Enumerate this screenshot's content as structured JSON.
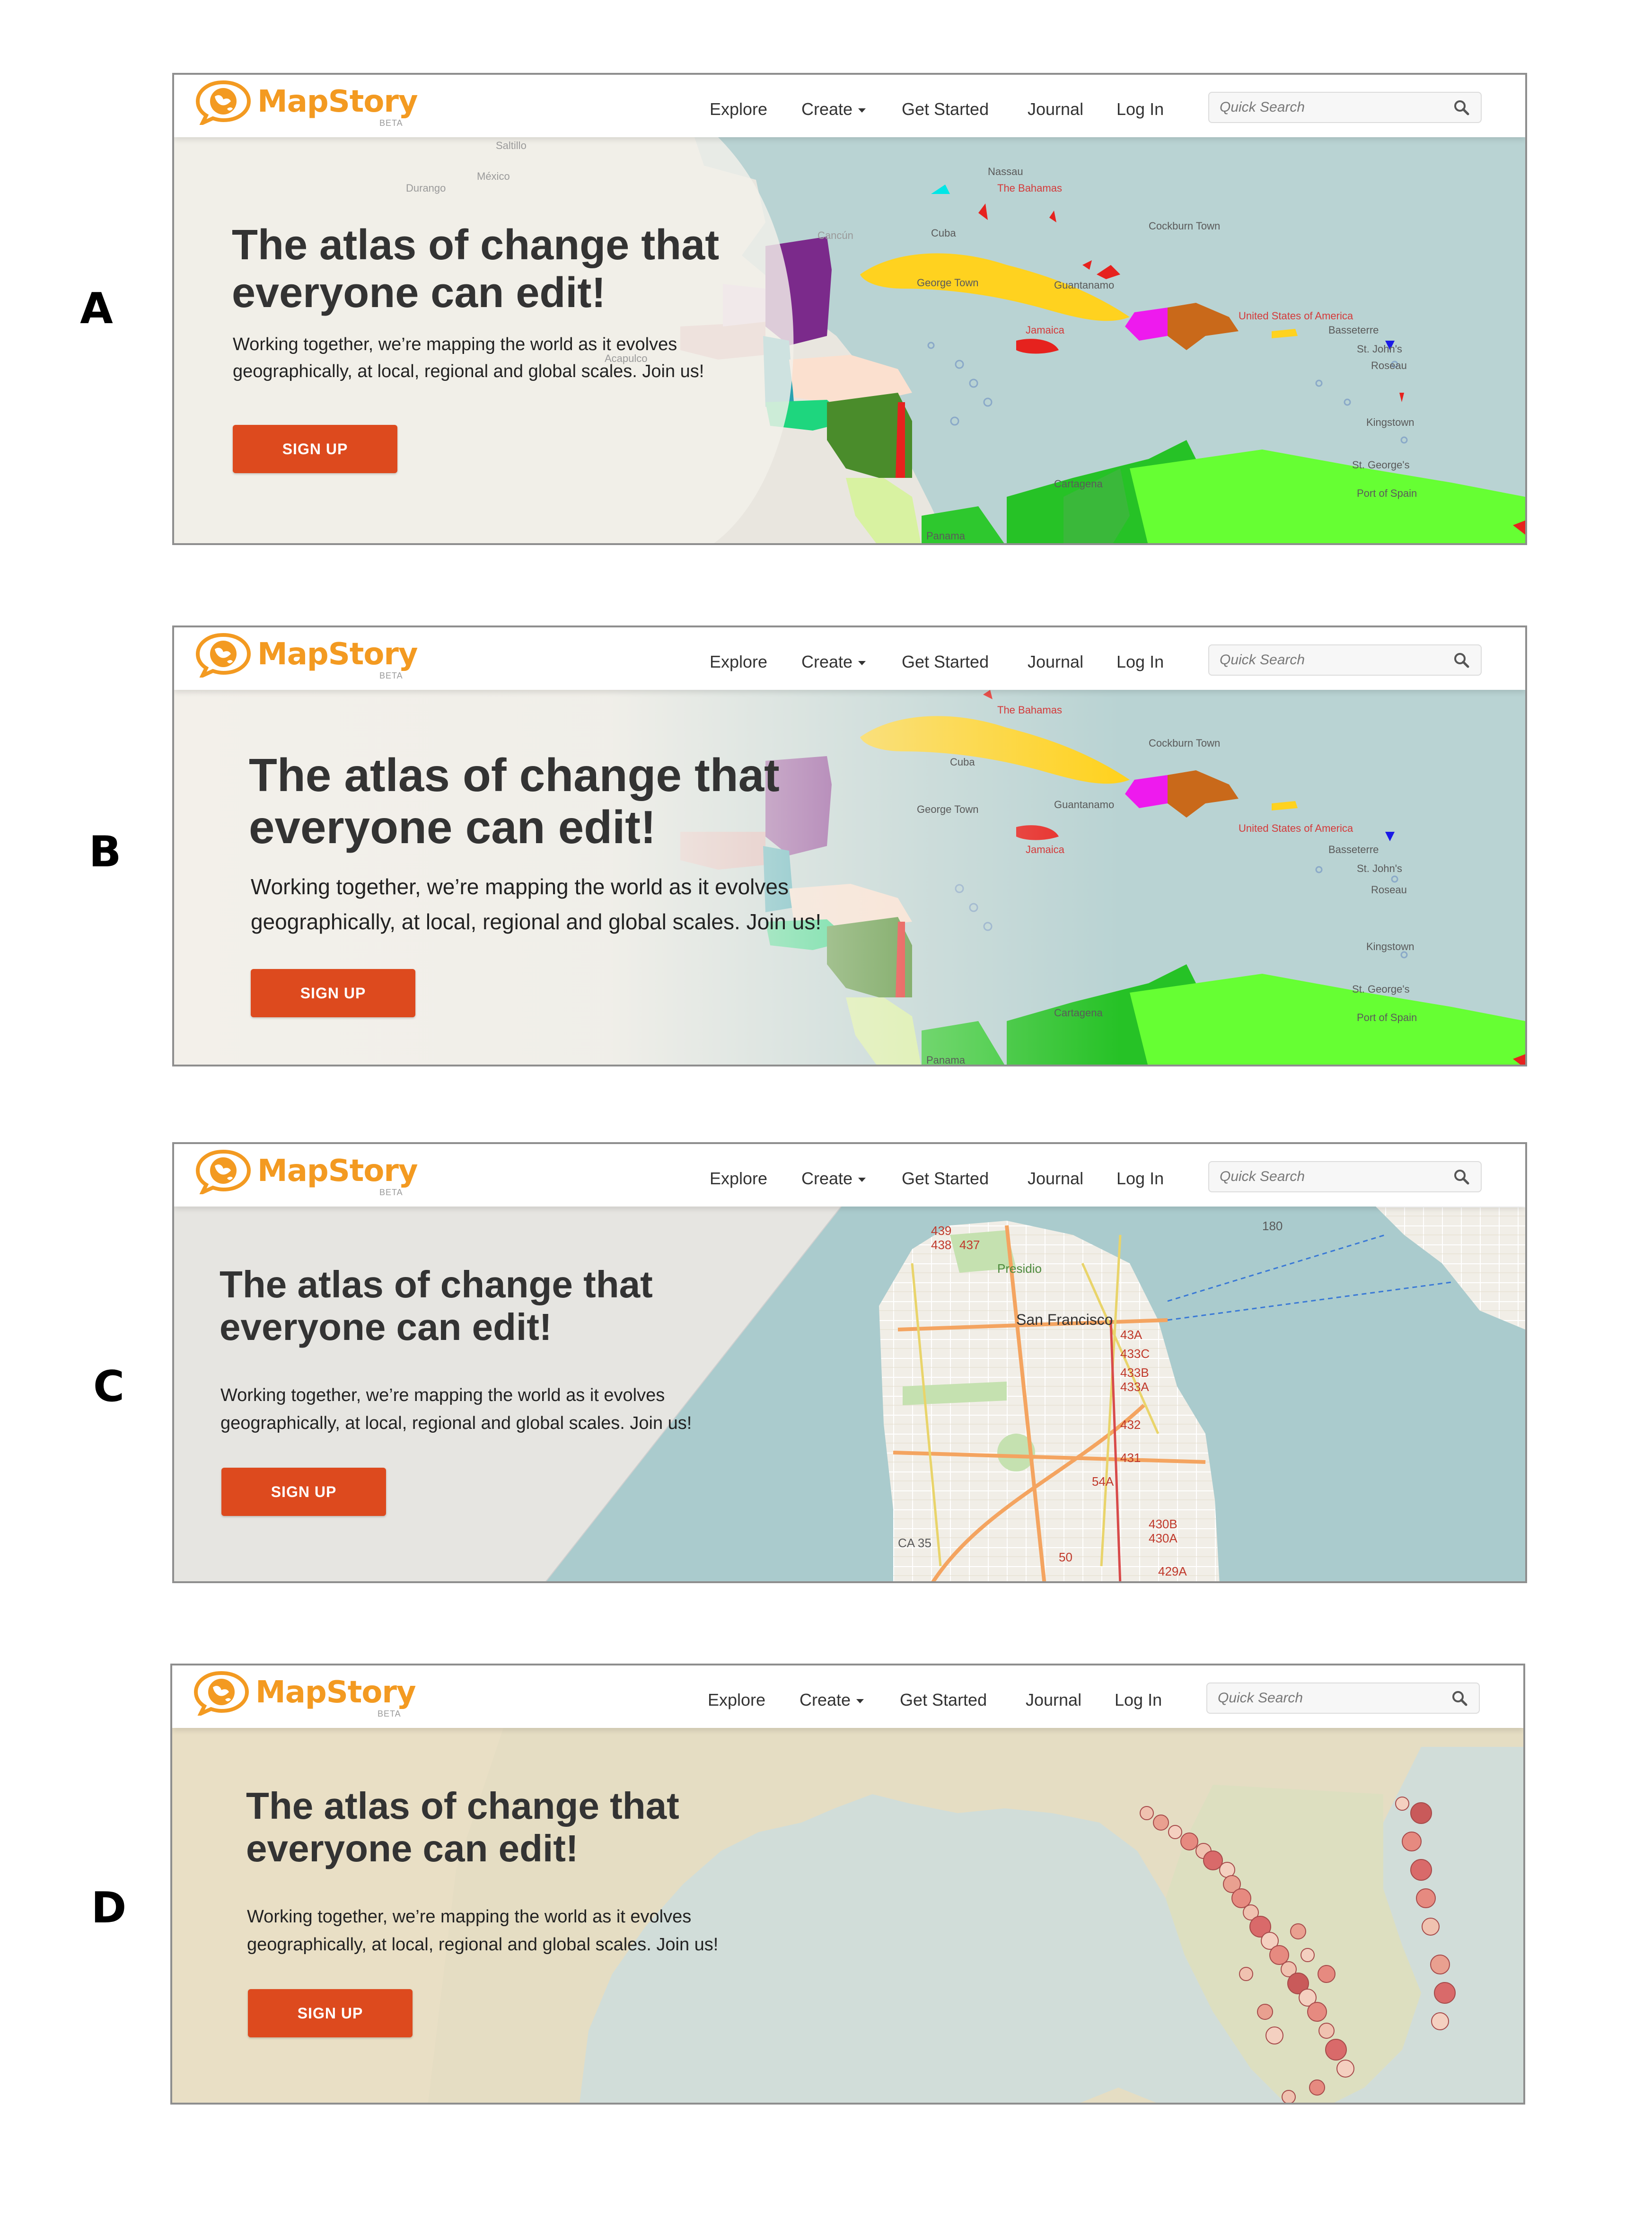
{
  "panel_labels": [
    "A",
    "B",
    "C",
    "D"
  ],
  "brand": {
    "name": "MapStory",
    "badge": "BETA",
    "color": "#f39a21"
  },
  "nav": {
    "explore": "Explore",
    "create": "Create",
    "get_started": "Get Started",
    "journal": "Journal",
    "login": "Log In"
  },
  "search": {
    "placeholder": "Quick Search",
    "icon": "search-icon"
  },
  "hero": {
    "title_line1": "The atlas of change that",
    "title_line2": "everyone can edit!",
    "subtitle_line1": "Working together, we’re mapping the world as it evolves",
    "subtitle_line2": "geographically, at local, regional and global scales. Join us!",
    "cta": "SIGN UP",
    "cta_color": "#dd4a1e"
  },
  "map_labels": {
    "caribbean": [
      "Nassau",
      "The Bahamas",
      "Cuba",
      "Cockburn Town",
      "George Town",
      "Guantanamo",
      "Jamaica",
      "United States of America",
      "Basseterre",
      "St. John's",
      "Roseau",
      "Kingstown",
      "St. George's",
      "Port of Spain",
      "Cartagena",
      "Panama",
      "México",
      "Durango",
      "Saltillo",
      "Acapulco",
      "Cancún"
    ],
    "san_francisco": [
      "San Francisco",
      "CA 35",
      "180",
      "43A",
      "433C",
      "433B",
      "433A",
      "432",
      "431",
      "54A",
      "50",
      "429A",
      "430B",
      "430A",
      "437",
      "438",
      "439",
      "Presidio"
    ]
  }
}
